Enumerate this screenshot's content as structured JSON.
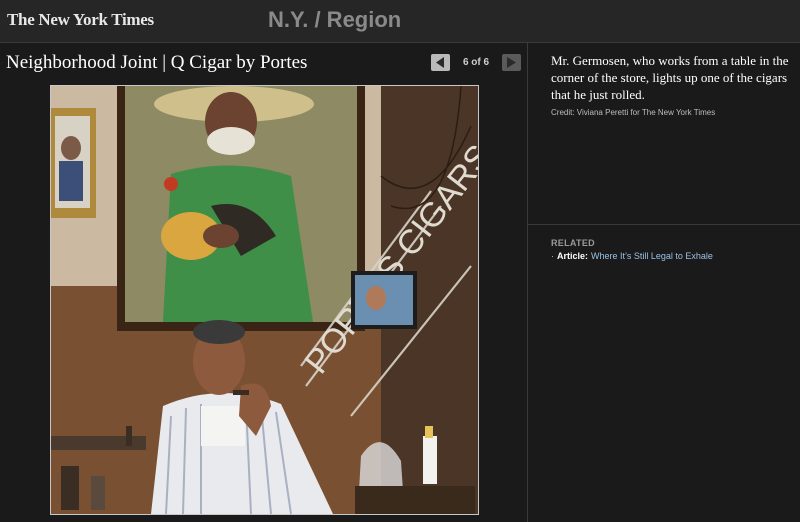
{
  "header": {
    "logo_text": "The New York Times",
    "section_title": "N.Y. / Region"
  },
  "slideshow": {
    "headline": "Neighborhood Joint | Q Cigar by Portes",
    "counter": "6 of 6",
    "photo_sign_text": "PORTES CIGARS"
  },
  "sidebar": {
    "caption": "Mr. Germosen, who works from a table in the corner of the store, lights up one of the cigars that he just rolled.",
    "credit": "Credit: Viviana Peretti for The New York Times",
    "related_title": "RELATED",
    "related_items": [
      {
        "bullet": "·",
        "label": "Article:",
        "link_text": "Where It’s Still Legal to Exhale"
      }
    ]
  },
  "colors": {
    "background": "#1a1a1a",
    "link": "#9bc1e5",
    "section_title": "#8a8a8a"
  }
}
